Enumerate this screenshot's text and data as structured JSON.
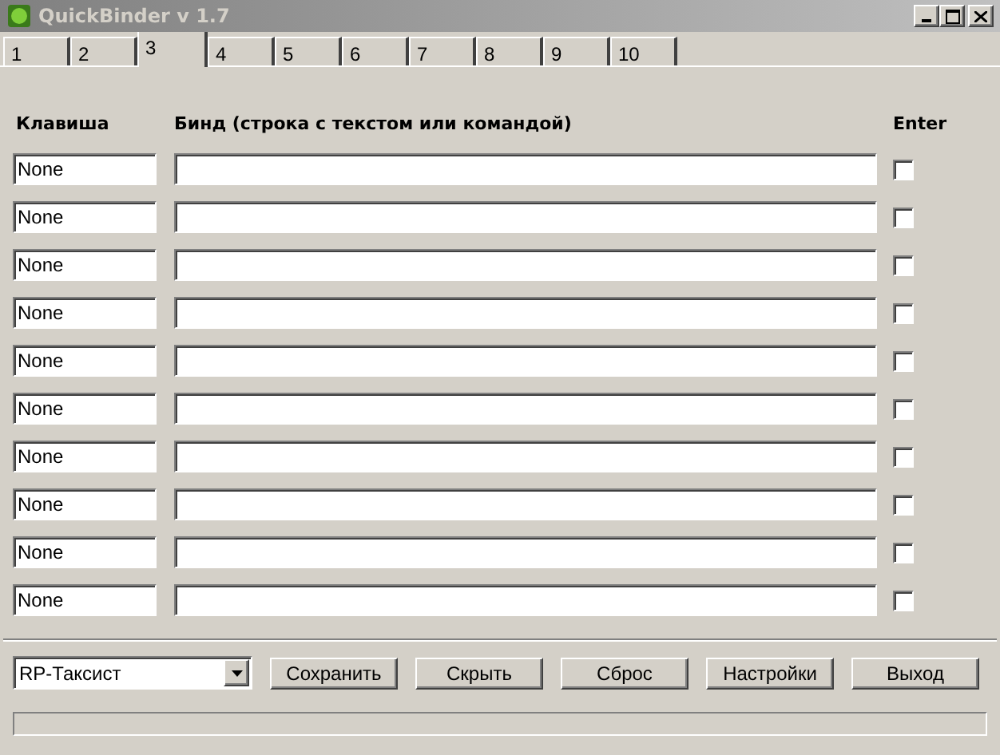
{
  "window": {
    "title": "QuickBinder v 1.7"
  },
  "tabs": [
    {
      "label": "1",
      "selected": false
    },
    {
      "label": "2",
      "selected": false
    },
    {
      "label": "3",
      "selected": true
    },
    {
      "label": "4",
      "selected": false
    },
    {
      "label": "5",
      "selected": false
    },
    {
      "label": "6",
      "selected": false
    },
    {
      "label": "7",
      "selected": false
    },
    {
      "label": "8",
      "selected": false
    },
    {
      "label": "9",
      "selected": false
    },
    {
      "label": "10",
      "selected": false
    }
  ],
  "columns": [
    "Клавиша",
    "Бинд (строка с текстом или командой)",
    "Enter"
  ],
  "rows": [
    {
      "key": "None",
      "enter": false
    },
    {
      "key": "None",
      "enter": false
    },
    {
      "key": "None",
      "enter": false
    },
    {
      "key": "None",
      "enter": false
    },
    {
      "key": "None",
      "enter": false
    },
    {
      "key": "None",
      "enter": false
    },
    {
      "key": "None",
      "enter": false
    },
    {
      "key": "None",
      "enter": false
    },
    {
      "key": "None",
      "enter": false
    },
    {
      "key": "None",
      "enter": false
    }
  ],
  "profile": "RP-Таксист",
  "buttons": [
    "Сохранить",
    "Скрыть",
    "Сброс",
    "Настройки",
    "Выход"
  ]
}
